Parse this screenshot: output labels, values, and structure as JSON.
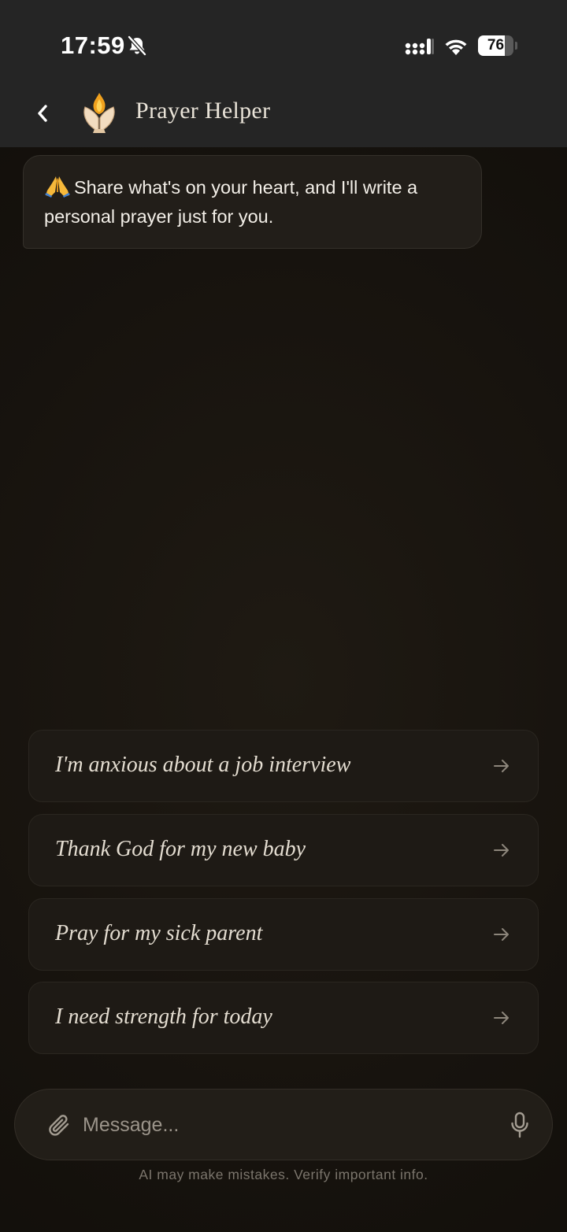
{
  "status_bar": {
    "time": "17:59",
    "battery_level": 76,
    "battery_text": "76",
    "icons": [
      "bell-slash-icon",
      "cellular-signal-icon",
      "wifi-icon",
      "battery-icon"
    ]
  },
  "header": {
    "title": "Prayer Helper",
    "back_icon": "chevron-left-icon",
    "logo_icon": "praying-hands-flame-icon"
  },
  "greeting": {
    "emoji_icon": "folded-hands-emoji",
    "text": "Share what's on your heart, and I'll write a personal prayer just for you."
  },
  "suggestions": [
    {
      "label": "I'm anxious about a job interview",
      "icon": "arrow-right-icon"
    },
    {
      "label": "Thank God for my new baby",
      "icon": "arrow-right-icon"
    },
    {
      "label": "Pray for my sick parent",
      "icon": "arrow-right-icon"
    },
    {
      "label": "I need strength for today",
      "icon": "arrow-right-icon"
    }
  ],
  "composer": {
    "placeholder": "Message...",
    "value": "",
    "attach_icon": "paperclip-icon",
    "mic_icon": "microphone-icon"
  },
  "footer": {
    "disclaimer": "AI may make mistakes. Verify important info."
  },
  "colors": {
    "background": "#15120e",
    "header": "#252525",
    "card": "#1e1a15",
    "text": "#f2ede4",
    "muted": "#7b756c"
  }
}
